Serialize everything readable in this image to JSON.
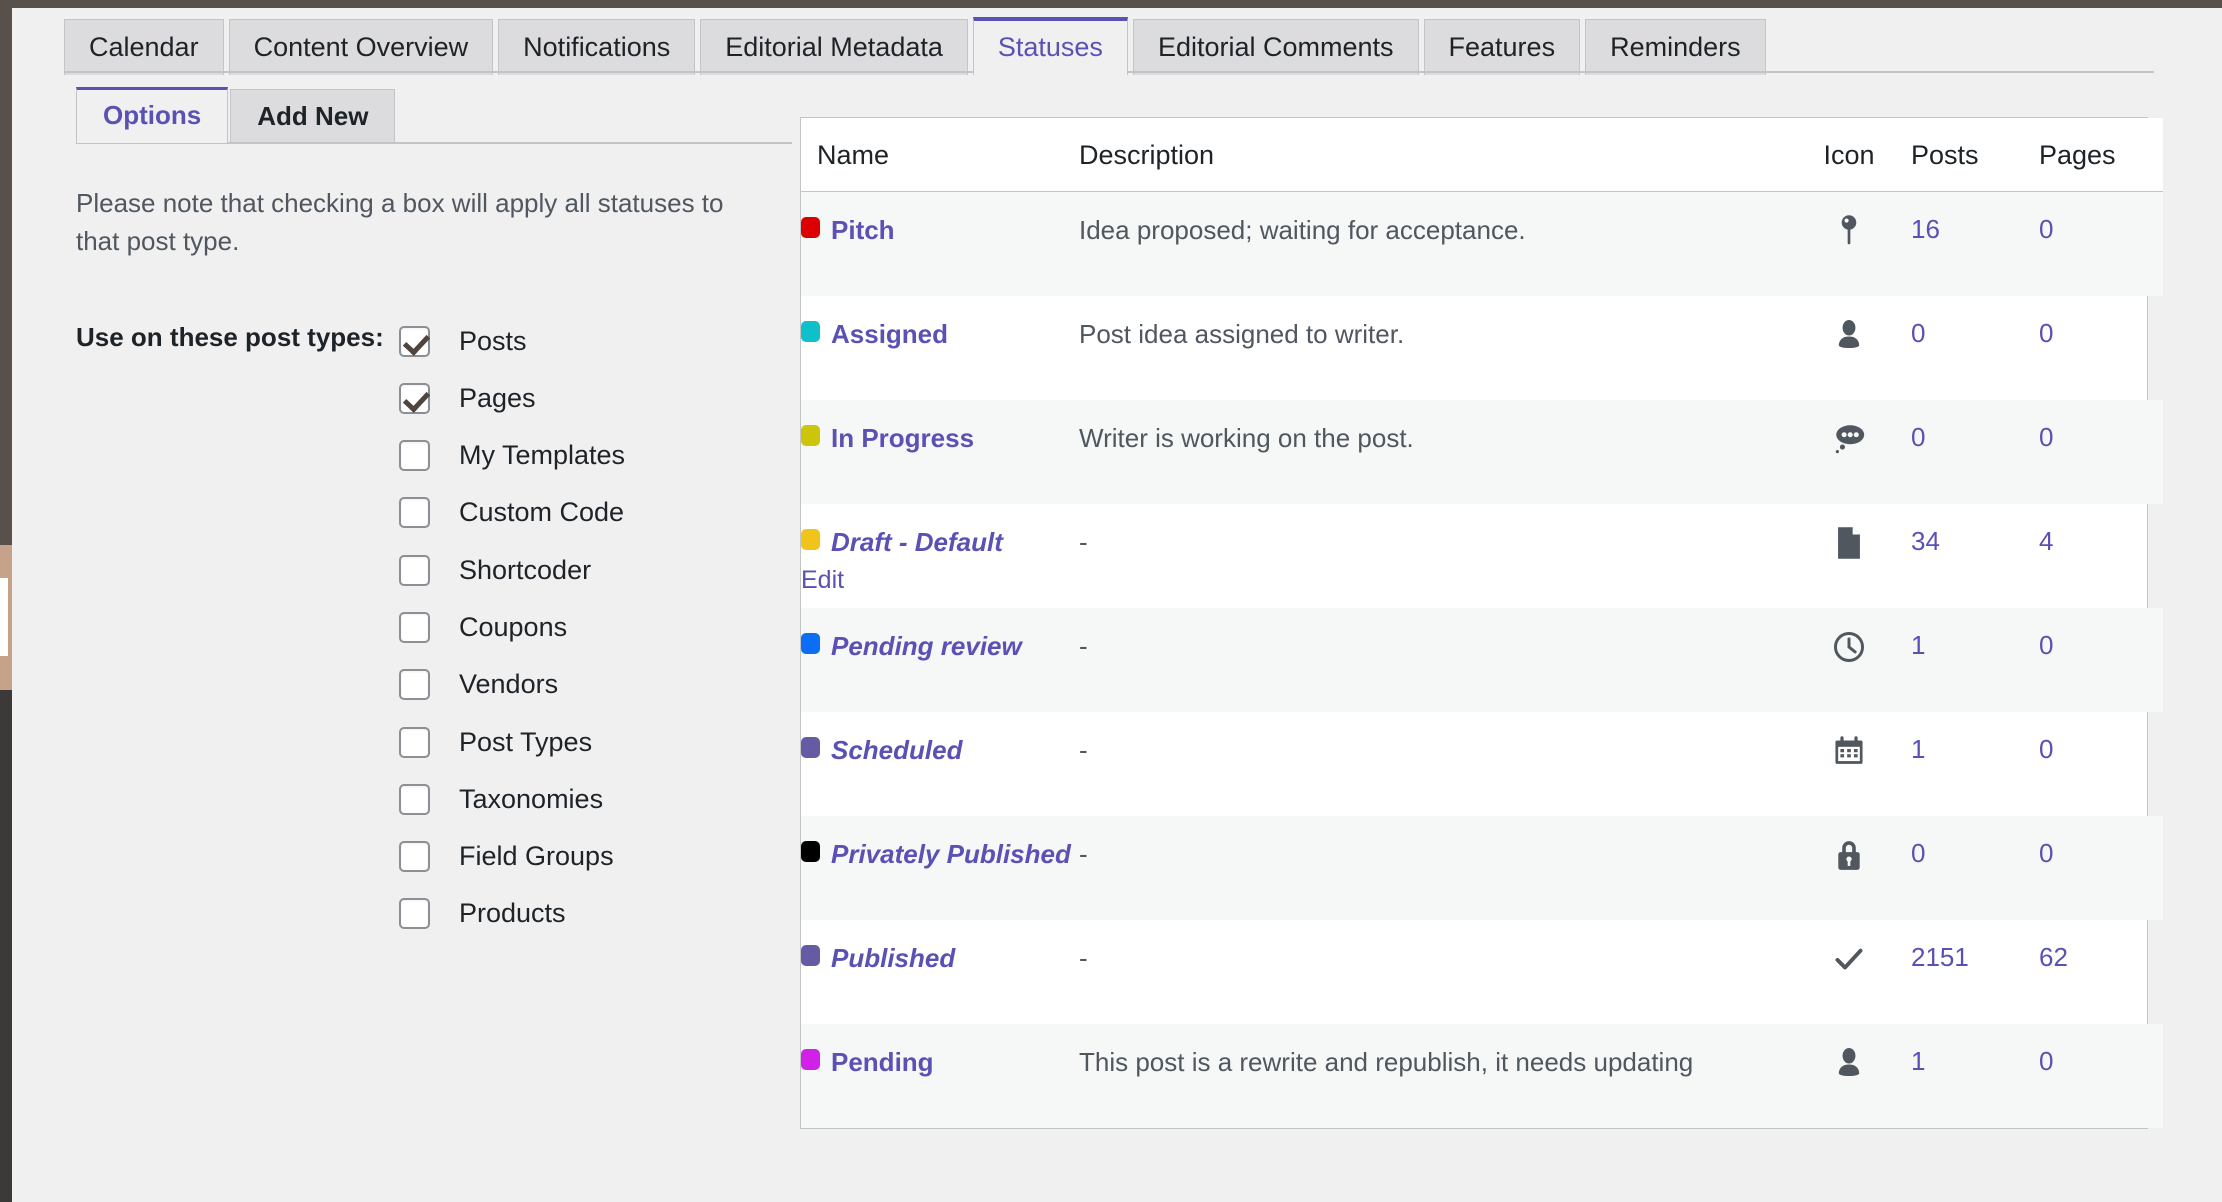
{
  "main_tabs": [
    {
      "label": "Calendar",
      "active": false
    },
    {
      "label": "Content Overview",
      "active": false
    },
    {
      "label": "Notifications",
      "active": false
    },
    {
      "label": "Editorial Metadata",
      "active": false
    },
    {
      "label": "Statuses",
      "active": true
    },
    {
      "label": "Editorial Comments",
      "active": false
    },
    {
      "label": "Features",
      "active": false
    },
    {
      "label": "Reminders",
      "active": false
    }
  ],
  "left_panel": {
    "sub_tabs": [
      {
        "label": "Options",
        "active": true
      },
      {
        "label": "Add New",
        "active": false
      }
    ],
    "note": "Please note that checking a box will apply all statuses to that post type.",
    "post_types_legend": "Use on these post types:",
    "post_types": [
      {
        "label": "Posts",
        "checked": true
      },
      {
        "label": "Pages",
        "checked": true
      },
      {
        "label": "My Templates",
        "checked": false
      },
      {
        "label": "Custom Code",
        "checked": false
      },
      {
        "label": "Shortcoder",
        "checked": false
      },
      {
        "label": "Coupons",
        "checked": false
      },
      {
        "label": "Vendors",
        "checked": false
      },
      {
        "label": "Post Types",
        "checked": false
      },
      {
        "label": "Taxonomies",
        "checked": false
      },
      {
        "label": "Field Groups",
        "checked": false
      },
      {
        "label": "Products",
        "checked": false
      }
    ]
  },
  "table": {
    "columns": [
      "Name",
      "Description",
      "Icon",
      "Posts",
      "Pages"
    ],
    "rows": [
      {
        "name": "Pitch",
        "italic": false,
        "dot_color": "#dc0000",
        "description": "Idea proposed; waiting for acceptance.",
        "icon": "pin-icon",
        "posts": "16",
        "pages": "0",
        "edit_label": null
      },
      {
        "name": "Assigned",
        "italic": false,
        "dot_color": "#0ec0ca",
        "description": "Post idea assigned to writer.",
        "icon": "user-icon",
        "posts": "0",
        "pages": "0",
        "edit_label": null
      },
      {
        "name": "In Progress",
        "italic": false,
        "dot_color": "#ccc50a",
        "description": "Writer is working on the post.",
        "icon": "comment-dots-icon",
        "posts": "0",
        "pages": "0",
        "edit_label": null
      },
      {
        "name": "Draft - Default",
        "italic": true,
        "dot_color": "#f0c419",
        "description": "-",
        "icon": "document-icon",
        "posts": "34",
        "pages": "4",
        "edit_label": "Edit"
      },
      {
        "name": "Pending review",
        "italic": true,
        "dot_color": "#0b6ef5",
        "description": "-",
        "icon": "clock-icon",
        "posts": "1",
        "pages": "0",
        "edit_label": null
      },
      {
        "name": "Scheduled",
        "italic": true,
        "dot_color": "#655ba5",
        "description": "-",
        "icon": "calendar-icon",
        "posts": "1",
        "pages": "0",
        "edit_label": null
      },
      {
        "name": "Privately Published",
        "italic": true,
        "dot_color": "#000000",
        "description": "-",
        "icon": "lock-icon",
        "posts": "0",
        "pages": "0",
        "edit_label": null
      },
      {
        "name": "Published",
        "italic": true,
        "dot_color": "#655ba5",
        "description": "-",
        "icon": "check-icon",
        "posts": "2151",
        "pages": "62",
        "edit_label": null
      },
      {
        "name": "Pending",
        "italic": false,
        "dot_color": "#d121e8",
        "description": "This post is a rewrite and republish, it needs updating",
        "icon": "user-icon",
        "posts": "1",
        "pages": "0",
        "edit_label": null
      }
    ]
  },
  "colors": {
    "accent": "#5a51b5",
    "page_bg": "#f0f0f1",
    "row_alt_bg": "#f6f7f7",
    "border": "#c3c4c7"
  }
}
